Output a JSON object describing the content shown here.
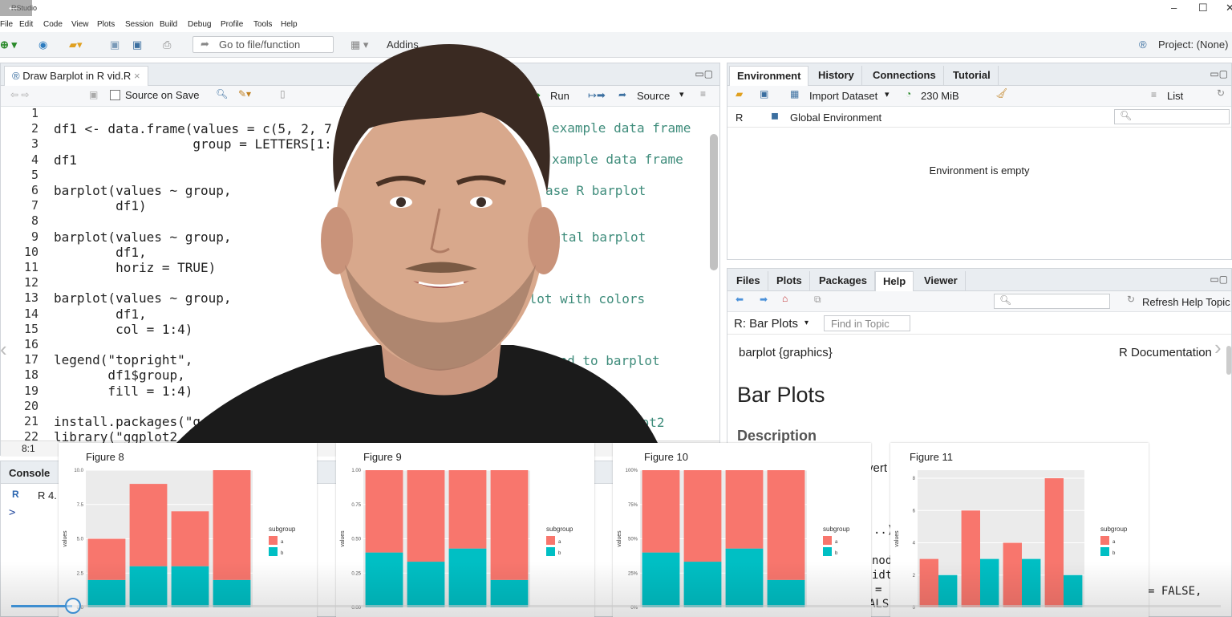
{
  "app": {
    "title": "RStudio",
    "win_min": "–",
    "win_max": "☐",
    "win_close": "✕"
  },
  "menu": [
    "File",
    "Edit",
    "Code",
    "View",
    "Plots",
    "Session",
    "Build",
    "Debug",
    "Profile",
    "Tools",
    "Help"
  ],
  "toolbar": {
    "goto_placeholder": "Go to file/function",
    "addins": "Addins",
    "project": "Project: (None)"
  },
  "editor": {
    "tab_label": "Draw Barplot in R vid.R",
    "source_on_save": "Source on Save",
    "run": "Run",
    "source": "Source",
    "status_pos": "8:1",
    "lines": [
      {
        "n": "1",
        "code": ""
      },
      {
        "n": "2",
        "code": "df1 <- data.frame(values = c(5, 2, 7"
      },
      {
        "n": "3",
        "code": "                  group = LETTERS[1:"
      },
      {
        "n": "4",
        "code": "df1"
      },
      {
        "n": "5",
        "code": ""
      },
      {
        "n": "6",
        "code": "barplot(values ~ group,"
      },
      {
        "n": "7",
        "code": "        df1)"
      },
      {
        "n": "8",
        "code": ""
      },
      {
        "n": "9",
        "code": "barplot(values ~ group,"
      },
      {
        "n": "10",
        "code": "        df1,"
      },
      {
        "n": "11",
        "code": "        horiz = TRUE)"
      },
      {
        "n": "12",
        "code": ""
      },
      {
        "n": "13",
        "code": "barplot(values ~ group,"
      },
      {
        "n": "14",
        "code": "        df1,"
      },
      {
        "n": "15",
        "code": "        col = 1:4)"
      },
      {
        "n": "16",
        "code": ""
      },
      {
        "n": "17",
        "code": "legend(\"topright\","
      },
      {
        "n": "18",
        "code": "       df1$group,"
      },
      {
        "n": "19",
        "code": "       fill = 1:4)"
      },
      {
        "n": "20",
        "code": ""
      },
      {
        "n": "21",
        "code": "install.packages(\"g"
      },
      {
        "n": "22",
        "code": "library(\"ggplot2"
      }
    ],
    "comments": [
      "example data frame",
      "xample data frame",
      "ase R barplot",
      "ontal barplot",
      "plot with colors",
      "dd legend to barplot",
      "lot2"
    ]
  },
  "console": {
    "tab": "Console",
    "version": "R 4.",
    "prompt": ">"
  },
  "environment": {
    "tabs": [
      "Environment",
      "History",
      "Connections",
      "Tutorial"
    ],
    "import": "Import Dataset",
    "mem": "230 MiB",
    "list": "List",
    "r_label": "R",
    "global": "Global Environment",
    "empty": "Environment is empty"
  },
  "help": {
    "tabs": [
      "Files",
      "Plots",
      "Packages",
      "Help",
      "Viewer"
    ],
    "refresh": "Refresh Help Topic",
    "topic": "R: Bar Plots",
    "find_placeholder": "Find in Topic",
    "pkg": "barplot {graphics}",
    "rdoc": "R Documentation",
    "heading": "Bar Plots",
    "section": "Description",
    "frag1": "vert",
    "frag2": "..)",
    "frag3": "nod",
    "frag4": "idt",
    "frag5": "=",
    "frag6": "ALS",
    "frag7": "= FALSE,"
  },
  "figures": [
    {
      "title": "Figure 8",
      "ylabels": [
        "10.0",
        "7.5",
        "5.0",
        "2.5",
        "0.0"
      ],
      "legend_title": "subgroup",
      "legend": [
        "a",
        "b"
      ],
      "ylabel": "values"
    },
    {
      "title": "Figure 9",
      "ylabels": [
        "1.00",
        "0.75",
        "0.50",
        "0.25",
        "0.00"
      ],
      "legend_title": "subgroup",
      "legend": [
        "a",
        "b"
      ],
      "ylabel": "values"
    },
    {
      "title": "Figure 10",
      "ylabels": [
        "100%",
        "75%",
        "50%",
        "25%",
        "0%"
      ],
      "legend_title": "subgroup",
      "legend": [
        "a",
        "b"
      ],
      "ylabel": "values"
    },
    {
      "title": "Figure 11",
      "ylabels": [
        "8",
        "6",
        "4",
        "2",
        "0"
      ],
      "legend_title": "subgroup",
      "legend": [
        "a",
        "b"
      ],
      "ylabel": "values"
    }
  ],
  "chart_data": [
    {
      "type": "bar",
      "stacked": true,
      "series": [
        {
          "name": "a",
          "values": [
            3,
            6,
            4,
            8
          ]
        },
        {
          "name": "b",
          "values": [
            2,
            3,
            3,
            2
          ]
        }
      ],
      "ylim": [
        0,
        10
      ],
      "colors": {
        "a": "#F8766D",
        "b": "#00BFC4"
      }
    },
    {
      "type": "bar",
      "stacked": true,
      "normalized": true,
      "series": [
        {
          "name": "a",
          "values": [
            0.6,
            0.667,
            0.571,
            0.8
          ]
        },
        {
          "name": "b",
          "values": [
            0.4,
            0.333,
            0.429,
            0.2
          ]
        }
      ],
      "ylim": [
        0,
        1
      ]
    },
    {
      "type": "bar",
      "stacked": true,
      "normalized": true,
      "percent": true,
      "series": [
        {
          "name": "a",
          "values": [
            60,
            66.7,
            57.1,
            80
          ]
        },
        {
          "name": "b",
          "values": [
            40,
            33.3,
            42.9,
            20
          ]
        }
      ],
      "ylim": [
        0,
        100
      ]
    },
    {
      "type": "bar",
      "dodged": true,
      "series": [
        {
          "name": "a",
          "values": [
            3,
            6,
            4,
            8
          ]
        },
        {
          "name": "b",
          "values": [
            2,
            3,
            3,
            2
          ]
        }
      ],
      "ylim": [
        0,
        8.5
      ]
    }
  ],
  "colors": {
    "a": "#F8766D",
    "b": "#00BFC4",
    "accent": "#4a90d9"
  }
}
